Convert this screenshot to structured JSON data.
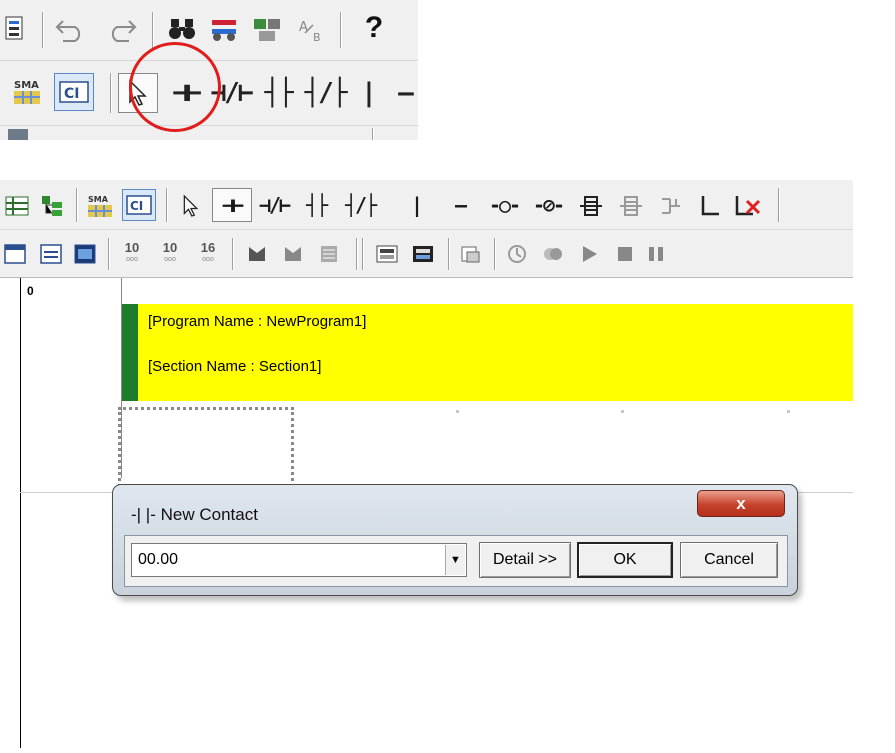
{
  "top_toolbar": {
    "help_glyph": "?",
    "ladder_tools": [
      "⊣⊢",
      "⊣/⊢",
      "┤├",
      "┤/├",
      "|",
      "—"
    ]
  },
  "toolbar_a": {
    "tool_glyphs": [
      "⊣⊢",
      "⊣/⊢",
      "┤├",
      "┤/├",
      "|",
      "—",
      "-○-",
      "-⊘-"
    ]
  },
  "toolbar_b": {
    "numeric_tools": [
      {
        "big": "10",
        "small": "ooo"
      },
      {
        "big": "10",
        "small": "ooo"
      },
      {
        "big": "16",
        "small": "ooo"
      }
    ]
  },
  "ladder": {
    "rung_number": "0",
    "program_name": "[Program Name : NewProgram1]",
    "section_name": "[Section Name : Section1]"
  },
  "dialog": {
    "title": "-| |- New Contact",
    "close_glyph": "x",
    "contact_value": "00.00",
    "detail_label": "Detail >>",
    "ok_label": "OK",
    "cancel_label": "Cancel"
  },
  "colors": {
    "comment_background": "#ffff00",
    "comment_bar": "#1e7d2a",
    "highlight_circle": "#e21b1b",
    "close_button": "#c6422c"
  }
}
